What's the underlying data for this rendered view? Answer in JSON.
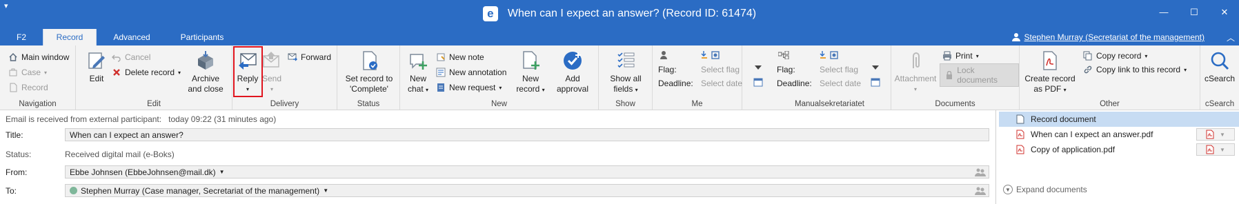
{
  "window": {
    "title": "When can I expect an answer? (Record ID: 61474)",
    "logo_letter": "e",
    "menu_glyph": "▾",
    "minimize": "—",
    "maximize": "☐",
    "close": "✕"
  },
  "tabs": [
    "F2",
    "Record",
    "Advanced",
    "Participants"
  ],
  "active_tab": "Record",
  "user": "Stephen Murray (Secretariat of the management)",
  "ribbon": {
    "navigation": {
      "label": "Navigation",
      "main_window": "Main window",
      "case": "Case",
      "record": "Record"
    },
    "edit": {
      "label": "Edit",
      "edit": "Edit",
      "cancel": "Cancel",
      "delete_record": "Delete record",
      "archive_close": [
        "Archive",
        "and close"
      ]
    },
    "delivery": {
      "label": "Delivery",
      "reply": "Reply",
      "send": "Send",
      "forward": "Forward"
    },
    "status": {
      "label": "Status",
      "set_record": [
        "Set record to",
        "'Complete'"
      ]
    },
    "new": {
      "label": "New",
      "new_chat": [
        "New",
        "chat"
      ],
      "new_note": "New note",
      "new_annotation": "New annotation",
      "new_request": "New request",
      "new_record": [
        "New",
        "record"
      ],
      "add_approval": [
        "Add",
        "approval"
      ]
    },
    "show": {
      "label": "Show",
      "show_all": [
        "Show all",
        "fields"
      ]
    },
    "me": {
      "label": "Me",
      "flag": "Flag:",
      "deadline": "Deadline:",
      "select_flag": "Select flag",
      "select_date": "Select date"
    },
    "manual": {
      "label": "Manualsekretariatet",
      "flag": "Flag:",
      "deadline": "Deadline:",
      "select_flag": "Select flag",
      "select_date": "Select date"
    },
    "documents": {
      "label": "Documents",
      "attachment": "Attachment",
      "print": "Print",
      "lock_documents": "Lock documents"
    },
    "other": {
      "label": "Other",
      "create_pdf": [
        "Create record",
        "as PDF"
      ],
      "copy_record": "Copy record",
      "copy_link": "Copy link to this record"
    },
    "csearch": {
      "label": "cSearch",
      "csearch": "cSearch"
    }
  },
  "record": {
    "received_text": "Email is received from external participant:",
    "received_time": "today 09:22 (31 minutes ago)",
    "title_label": "Title:",
    "title_value": "When can I expect an answer?",
    "status_label": "Status:",
    "status_value": "Received digital mail (e-Boks)",
    "from_label": "From:",
    "from_value": "Ebbe Johnsen (EbbeJohnsen@mail.dk)",
    "to_label": "To:",
    "to_value": "Stephen Murray (Case manager, Secretariat of the management)"
  },
  "documents_panel": {
    "items": [
      {
        "name": "Record document",
        "type": "doc"
      },
      {
        "name": "When can I expect an answer.pdf",
        "type": "pdf"
      },
      {
        "name": "Copy of application.pdf",
        "type": "pdf"
      }
    ],
    "expand": "Expand documents"
  },
  "colors": {
    "accent": "#2b6cc4",
    "highlight": "#e0141e",
    "selected_row": "#c7dcf3"
  }
}
